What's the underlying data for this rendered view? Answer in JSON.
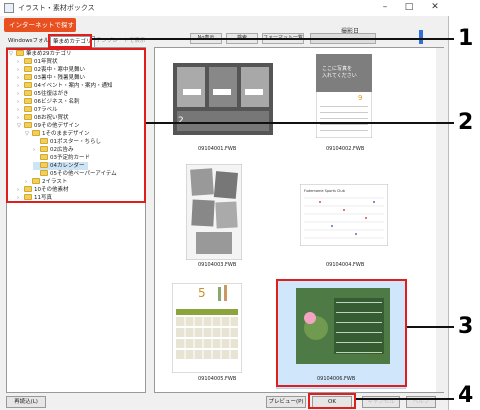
{
  "window": {
    "title": "イラスト・素材ボックス",
    "minimize": "–",
    "maximize": "□",
    "close": "✕"
  },
  "toolbar": {
    "internet_button": "インターネットで探す ▸",
    "btn1": "No表示",
    "btn2": "検索",
    "btn3": "フォーマット一覧",
    "date_label": "撮影日"
  },
  "tabs": [
    {
      "label": "Windowsフォル"
    },
    {
      "label": "筆まめカテゴリ"
    },
    {
      "label": "テンプレートで表示"
    }
  ],
  "tree": [
    {
      "label": "筆まめ29カテゴリ",
      "level": 0,
      "expander": "▽"
    },
    {
      "label": "01年賀状",
      "level": 1,
      "expander": "›"
    },
    {
      "label": "02喪中・寒中見舞い",
      "level": 1,
      "expander": "›"
    },
    {
      "label": "03暑中・残暑見舞い",
      "level": 1,
      "expander": "›"
    },
    {
      "label": "04イベント・案内・案内・通知",
      "level": 1,
      "expander": "›"
    },
    {
      "label": "05往復はがき",
      "level": 1,
      "expander": "›"
    },
    {
      "label": "06ビジネス・名刺",
      "level": 1,
      "expander": "›"
    },
    {
      "label": "07ラベル",
      "level": 1,
      "expander": "›"
    },
    {
      "label": "08お祝い賀状",
      "level": 1,
      "expander": "›"
    },
    {
      "label": "09その他デザイン",
      "level": 1,
      "expander": "▽"
    },
    {
      "label": "1そのままデザイン",
      "level": 2,
      "expander": "▽"
    },
    {
      "label": "01ポスター・ちらし",
      "level": 3,
      "expander": ""
    },
    {
      "label": "02広告み",
      "level": 3,
      "expander": "›"
    },
    {
      "label": "03予定約カード",
      "level": 3,
      "expander": ""
    },
    {
      "label": "04カレンダー",
      "level": 3,
      "expander": "",
      "selected": true
    },
    {
      "label": "05その他ペーパーアイテム",
      "level": 3,
      "expander": ""
    },
    {
      "label": "2イラスト",
      "level": 2,
      "expander": "›"
    },
    {
      "label": "10その他素材",
      "level": 1,
      "expander": "›"
    },
    {
      "label": "11写真",
      "level": 1,
      "expander": "›"
    }
  ],
  "thumbnails": [
    {
      "filename": "09104001.FWB"
    },
    {
      "filename": "09104002.FWB"
    },
    {
      "filename": "09104003.FWB"
    },
    {
      "filename": "09104004.FWB"
    },
    {
      "filename": "09104005.FWB"
    },
    {
      "filename": "09104006.FWB",
      "selected": true
    }
  ],
  "thumb_text": {
    "t2_line1": "ここに写真を",
    "t2_line2": "入れてください",
    "t2_month": "9",
    "t4_title": "Fudemame Sports Club",
    "t5_month": "5",
    "t1_month": "2"
  },
  "bottom": {
    "reload": "再読込(L)",
    "preview": "プレビュー(P)",
    "ok": "OK",
    "cancel": "キャンセル",
    "help": "ヘルプ"
  },
  "callouts": [
    {
      "number": "1"
    },
    {
      "number": "2"
    },
    {
      "number": "3"
    },
    {
      "number": "4"
    }
  ],
  "colors": {
    "accent_orange": "#e8501f",
    "highlight_red": "#e01e1e",
    "selection_blue": "#cfe6fb",
    "folder_yellow": "#f2cf5b"
  }
}
